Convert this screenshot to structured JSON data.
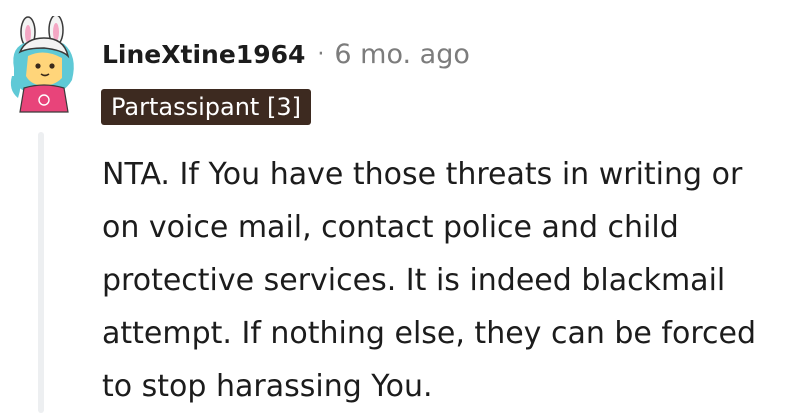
{
  "comment": {
    "author": "LineXtine1964",
    "separator": "·",
    "age": "6 mo. ago",
    "flair": "Partassipant [3]",
    "body": "NTA. If You have those threats in writing or on voice mail, contact police and child protective services. It is indeed blackmail attempt. If nothing else, they can be forced to stop harassing You."
  },
  "avatar": {
    "icon": "bunny-hood-avatar-icon",
    "colors": {
      "hood": "#f3f3f3",
      "ear_inner": "#f4a7c4",
      "face": "#ffd57a",
      "hair": "#5fc9d6",
      "shirt": "#e8447a"
    }
  },
  "colors": {
    "flair_bg": "#3d2a20",
    "flair_text": "#ffffff",
    "meta_text": "#7c7c7c",
    "body_text": "#1c1c1c",
    "thread_line": "#edeff1"
  }
}
